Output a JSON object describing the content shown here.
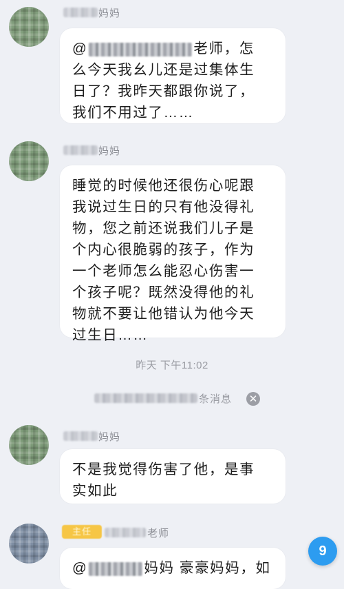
{
  "messages": [
    {
      "sender_suffix": "妈妈",
      "text_mention": "@",
      "text_after_mention": "老师，怎",
      "text_rest": "么今天我幺儿还是过集体生\n日了？我昨天都跟你说了，\n我们不用过了……"
    },
    {
      "sender_suffix": "妈妈",
      "text": "睡觉的时候他还很伤心呢跟\n我说过生日的只有他没得礼\n物，您之前还说我们儿子是\n个内心很脆弱的孩子，作为\n一个老师怎么能忍心伤害一\n个孩子呢？既然没得他的礼\n物就不要让他错认为他今天\n过生日……"
    },
    {
      "sender_suffix": "妈妈",
      "text": "不是我觉得伤害了他，是事\n实如此"
    },
    {
      "sender_suffix": "老师",
      "role_tag": "主任",
      "text_mention": "@",
      "text_after_mention": "妈妈 豪豪妈妈，如"
    }
  ],
  "timestamp": "昨天 下午11:02",
  "notice": {
    "text": "条消息",
    "close_glyph": "✕"
  },
  "unread_badge": "9",
  "colors": {
    "background": "#eef0f5",
    "bubble": "#ffffff",
    "badge": "#2d9cf0",
    "role_tag": "#f6c646"
  }
}
